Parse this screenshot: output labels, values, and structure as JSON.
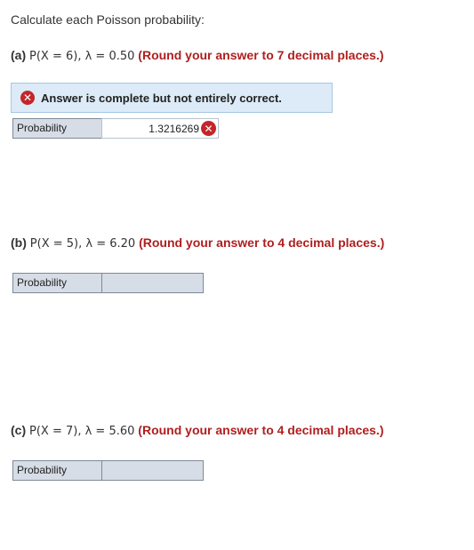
{
  "intro": "Calculate each Poisson probability:",
  "parts": [
    {
      "label": "(a)",
      "expr": "P(X = 6), λ = 0.50",
      "instruction": "(Round your answer to 7 decimal places.)"
    },
    {
      "label": "(b)",
      "expr": "P(X = 5), λ = 6.20",
      "instruction": "(Round your answer to 4 decimal places.)"
    },
    {
      "label": "(c)",
      "expr": "P(X = 7), λ = 5.60",
      "instruction": "(Round your answer to 4 decimal places.)"
    }
  ],
  "banner": {
    "text": "Answer is complete but not entirely correct.",
    "icon": "x-circle-icon",
    "color": "#c3262a"
  },
  "answers": [
    {
      "label": "Probability",
      "value": "1.3216269",
      "status": "incorrect"
    },
    {
      "label": "Probability",
      "value": ""
    },
    {
      "label": "Probability",
      "value": ""
    }
  ],
  "colors": {
    "accent": "#b01e1e",
    "banner_bg": "#dcebf7",
    "incorrect": "#c3262a"
  }
}
